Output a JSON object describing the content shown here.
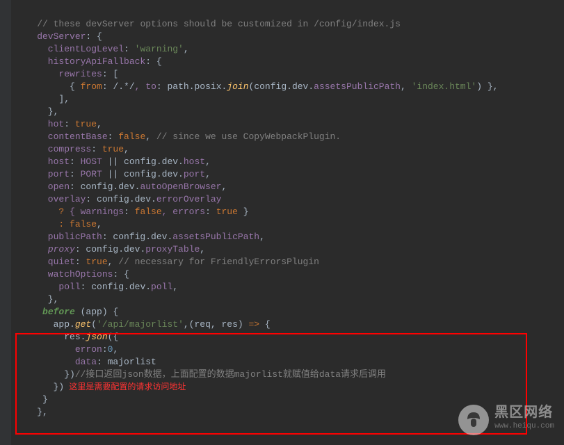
{
  "code": {
    "l01a": "    ",
    "l01b": "// these devServer options should be customized in /config/index.js",
    "l02a": "    devServer",
    "l02b": ": {",
    "l03a": "      clientLogLevel",
    "l03b": ": ",
    "l03c": "'warning'",
    "l03d": ",",
    "l04a": "      historyApiFallback",
    "l04b": ": {",
    "l05a": "        rewrites",
    "l05b": ": [",
    "l06a": "          { ",
    "l06b": "from",
    "l06c": ": ",
    "l06d": "/.*/",
    "l06e": ", to",
    "l06f": ": path.posix.",
    "l06g": "join",
    "l06h": "(config.dev.",
    "l06i": "assetsPublicPath",
    "l06j": ", ",
    "l06k": "'index.html'",
    "l06l": ") },",
    "l07": "        ],",
    "l08": "      },",
    "l09a": "      hot",
    "l09b": ": ",
    "l09c": "true",
    "l09d": ",",
    "l10a": "      contentBase",
    "l10b": ": ",
    "l10c": "false",
    "l10d": ", ",
    "l10e": "// since we use CopyWebpackPlugin.",
    "l11a": "      compress",
    "l11b": ": ",
    "l11c": "true",
    "l11d": ",",
    "l12a": "      host",
    "l12b": ": ",
    "l12c": "HOST",
    "l12d": " || config.dev.",
    "l12e": "host",
    "l12f": ",",
    "l13a": "      port",
    "l13b": ": ",
    "l13c": "PORT",
    "l13d": " || config.dev.",
    "l13e": "port",
    "l13f": ",",
    "l14a": "      open",
    "l14b": ": config.dev.",
    "l14c": "autoOpenBrowser",
    "l14d": ",",
    "l15a": "      overlay",
    "l15b": ": config.dev.",
    "l15c": "errorOverlay",
    "l16a": "        ",
    "l16b": "? ",
    "l16c": "{ warnings",
    "l16d": ": ",
    "l16e": "false",
    "l16f": ", errors",
    "l16g": ": ",
    "l16h": "true",
    "l16i": " }",
    "l17a": "        ",
    "l17b": ": ",
    "l17c": "false",
    "l17d": ",",
    "l18a": "      publicPath",
    "l18b": ": config.dev.",
    "l18c": "assetsPublicPath",
    "l18d": ",",
    "l19a": "      ",
    "l19b": "proxy",
    "l19c": ": config.dev.",
    "l19d": "proxyTable",
    "l19e": ",",
    "l20a": "      quiet",
    "l20b": ": ",
    "l20c": "true",
    "l20d": ", ",
    "l20e": "// necessary for FriendlyErrorsPlugin",
    "l21a": "      watchOptions",
    "l21b": ": {",
    "l22a": "        poll",
    "l22b": ": config.dev.",
    "l22c": "poll",
    "l22d": ",",
    "l23": "      },",
    "l24a": "     ",
    "l24b": "before ",
    "l24c": "(app) {",
    "l25a": "       app.",
    "l25b": "get",
    "l25c": "(",
    "l25d": "'/api/majorlist'",
    "l25e": ",(req, res) ",
    "l25f": "=>",
    "l25g": " {",
    "l26a": "         res.",
    "l26b": "json",
    "l26c": "({",
    "l27a": "           erron",
    "l27b": ":",
    "l27c": "0",
    "l27d": ",",
    "l28a": "           data",
    "l28b": ": majorlist",
    "l29a": "         })",
    "l29b": "//接口返回json数据，上面配置的数据majorlist就赋值给data请求后调用",
    "l30": "       })",
    "l30b": "        这里是需要配置的请求访问地址",
    "l31": "     }",
    "l32": "    },"
  },
  "watermark": {
    "title": "黑区网络",
    "sub": "www.heiqu.com"
  }
}
